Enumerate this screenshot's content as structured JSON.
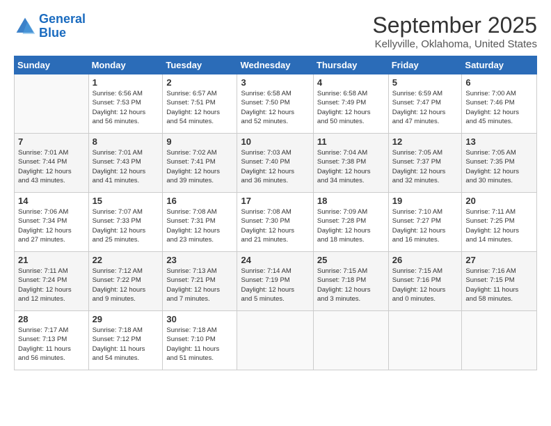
{
  "header": {
    "logo_line1": "General",
    "logo_line2": "Blue",
    "month": "September 2025",
    "location": "Kellyville, Oklahoma, United States"
  },
  "days_of_week": [
    "Sunday",
    "Monday",
    "Tuesday",
    "Wednesday",
    "Thursday",
    "Friday",
    "Saturday"
  ],
  "weeks": [
    [
      {
        "day": "",
        "info": ""
      },
      {
        "day": "1",
        "info": "Sunrise: 6:56 AM\nSunset: 7:53 PM\nDaylight: 12 hours\nand 56 minutes."
      },
      {
        "day": "2",
        "info": "Sunrise: 6:57 AM\nSunset: 7:51 PM\nDaylight: 12 hours\nand 54 minutes."
      },
      {
        "day": "3",
        "info": "Sunrise: 6:58 AM\nSunset: 7:50 PM\nDaylight: 12 hours\nand 52 minutes."
      },
      {
        "day": "4",
        "info": "Sunrise: 6:58 AM\nSunset: 7:49 PM\nDaylight: 12 hours\nand 50 minutes."
      },
      {
        "day": "5",
        "info": "Sunrise: 6:59 AM\nSunset: 7:47 PM\nDaylight: 12 hours\nand 47 minutes."
      },
      {
        "day": "6",
        "info": "Sunrise: 7:00 AM\nSunset: 7:46 PM\nDaylight: 12 hours\nand 45 minutes."
      }
    ],
    [
      {
        "day": "7",
        "info": "Sunrise: 7:01 AM\nSunset: 7:44 PM\nDaylight: 12 hours\nand 43 minutes."
      },
      {
        "day": "8",
        "info": "Sunrise: 7:01 AM\nSunset: 7:43 PM\nDaylight: 12 hours\nand 41 minutes."
      },
      {
        "day": "9",
        "info": "Sunrise: 7:02 AM\nSunset: 7:41 PM\nDaylight: 12 hours\nand 39 minutes."
      },
      {
        "day": "10",
        "info": "Sunrise: 7:03 AM\nSunset: 7:40 PM\nDaylight: 12 hours\nand 36 minutes."
      },
      {
        "day": "11",
        "info": "Sunrise: 7:04 AM\nSunset: 7:38 PM\nDaylight: 12 hours\nand 34 minutes."
      },
      {
        "day": "12",
        "info": "Sunrise: 7:05 AM\nSunset: 7:37 PM\nDaylight: 12 hours\nand 32 minutes."
      },
      {
        "day": "13",
        "info": "Sunrise: 7:05 AM\nSunset: 7:35 PM\nDaylight: 12 hours\nand 30 minutes."
      }
    ],
    [
      {
        "day": "14",
        "info": "Sunrise: 7:06 AM\nSunset: 7:34 PM\nDaylight: 12 hours\nand 27 minutes."
      },
      {
        "day": "15",
        "info": "Sunrise: 7:07 AM\nSunset: 7:33 PM\nDaylight: 12 hours\nand 25 minutes."
      },
      {
        "day": "16",
        "info": "Sunrise: 7:08 AM\nSunset: 7:31 PM\nDaylight: 12 hours\nand 23 minutes."
      },
      {
        "day": "17",
        "info": "Sunrise: 7:08 AM\nSunset: 7:30 PM\nDaylight: 12 hours\nand 21 minutes."
      },
      {
        "day": "18",
        "info": "Sunrise: 7:09 AM\nSunset: 7:28 PM\nDaylight: 12 hours\nand 18 minutes."
      },
      {
        "day": "19",
        "info": "Sunrise: 7:10 AM\nSunset: 7:27 PM\nDaylight: 12 hours\nand 16 minutes."
      },
      {
        "day": "20",
        "info": "Sunrise: 7:11 AM\nSunset: 7:25 PM\nDaylight: 12 hours\nand 14 minutes."
      }
    ],
    [
      {
        "day": "21",
        "info": "Sunrise: 7:11 AM\nSunset: 7:24 PM\nDaylight: 12 hours\nand 12 minutes."
      },
      {
        "day": "22",
        "info": "Sunrise: 7:12 AM\nSunset: 7:22 PM\nDaylight: 12 hours\nand 9 minutes."
      },
      {
        "day": "23",
        "info": "Sunrise: 7:13 AM\nSunset: 7:21 PM\nDaylight: 12 hours\nand 7 minutes."
      },
      {
        "day": "24",
        "info": "Sunrise: 7:14 AM\nSunset: 7:19 PM\nDaylight: 12 hours\nand 5 minutes."
      },
      {
        "day": "25",
        "info": "Sunrise: 7:15 AM\nSunset: 7:18 PM\nDaylight: 12 hours\nand 3 minutes."
      },
      {
        "day": "26",
        "info": "Sunrise: 7:15 AM\nSunset: 7:16 PM\nDaylight: 12 hours\nand 0 minutes."
      },
      {
        "day": "27",
        "info": "Sunrise: 7:16 AM\nSunset: 7:15 PM\nDaylight: 11 hours\nand 58 minutes."
      }
    ],
    [
      {
        "day": "28",
        "info": "Sunrise: 7:17 AM\nSunset: 7:13 PM\nDaylight: 11 hours\nand 56 minutes."
      },
      {
        "day": "29",
        "info": "Sunrise: 7:18 AM\nSunset: 7:12 PM\nDaylight: 11 hours\nand 54 minutes."
      },
      {
        "day": "30",
        "info": "Sunrise: 7:18 AM\nSunset: 7:10 PM\nDaylight: 11 hours\nand 51 minutes."
      },
      {
        "day": "",
        "info": ""
      },
      {
        "day": "",
        "info": ""
      },
      {
        "day": "",
        "info": ""
      },
      {
        "day": "",
        "info": ""
      }
    ]
  ]
}
